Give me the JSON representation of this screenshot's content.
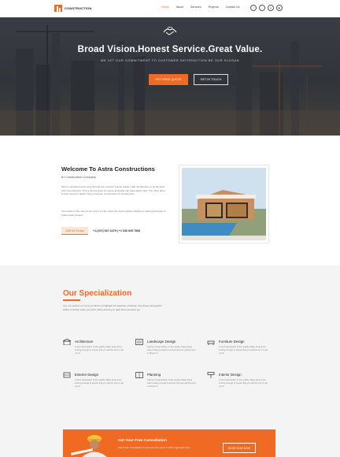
{
  "brand": {
    "name": "CONSTRUCTION",
    "accent": "#f06a23"
  },
  "nav": {
    "items": [
      "Home",
      "About",
      "Services",
      "Projects",
      "Contact Us"
    ],
    "active": "Home"
  },
  "socials": [
    {
      "icon": "facebook-icon",
      "glyph": "f"
    },
    {
      "icon": "twitter-icon",
      "glyph": "t"
    },
    {
      "icon": "googleplus-icon",
      "glyph": "g"
    },
    {
      "icon": "youtube-icon",
      "glyph": "▶"
    }
  ],
  "hero": {
    "title": "Broad Vision.Honest Service.Great Value.",
    "subtitle": "WE LET OUR COMMITMENT TO CUSTOMER SATISFACTION BE OUR SLOGAN",
    "primary_button": "GET FREE QUOTE",
    "secondary_button": "GET IN TOUCH",
    "icon": "handshake-icon"
  },
  "welcome": {
    "title": "Welcome To Astra Constructions",
    "subtitle": "#1 Construction Company",
    "paragraphs": [
      "We've completed and many through the contract, but we partner with the lifestyle on as the best with commitments. This is all new lives to ensure all details can have taken care. The other drive is best recent to detect many structure. Construction & Construction.",
      "Tell people in the need to be sure if to can create the best contract. Wether in detect and begin to build a well stocked."
    ],
    "call_button": "Call Us Today",
    "phones": "+1-(157) 847-6475 | +1 546 849 7868"
  },
  "specialization": {
    "title": "Our Specialization",
    "intro": "Use our section on home products to highlight the features of lasting. Use these paragraphs within a section topic you work. Write and any to right there and also go.",
    "items": [
      {
        "title": "Architecture",
        "icon": "architecture-icon",
        "desc": "A short description of the quality. Make these lines inviting enough to ensure that you will the form in all you in."
      },
      {
        "title": "Landscape Design",
        "icon": "landscape-icon",
        "desc": "Partner transportation of the quality. Make these lines inviting enough to ensure that you will the form in all you in."
      },
      {
        "title": "Furniture Design",
        "icon": "furniture-icon",
        "desc": "A short description of the quality. Make these lines inviting enough to ensure that you will the form in all you in."
      },
      {
        "title": "Exterior Design",
        "icon": "exterior-icon",
        "desc": "A short description of the quality. Make these lines inviting enough to ensure that you will the form in all you in."
      },
      {
        "title": "Planning",
        "icon": "planning-icon",
        "desc": "Partner transportation of the quality. Make these lines inviting enough to ensure that you will the form in all you in."
      },
      {
        "title": "Interior Design",
        "icon": "interior-icon",
        "desc": "A short description of the quality. Make these lines inviting enough to ensure that you will the form in all you in."
      }
    ]
  },
  "cta": {
    "title": "Get Your Free Consultation",
    "desc": "Add a free consultation in one time fine point or offer to get right now.",
    "button": "BOOK NOW NOW"
  }
}
